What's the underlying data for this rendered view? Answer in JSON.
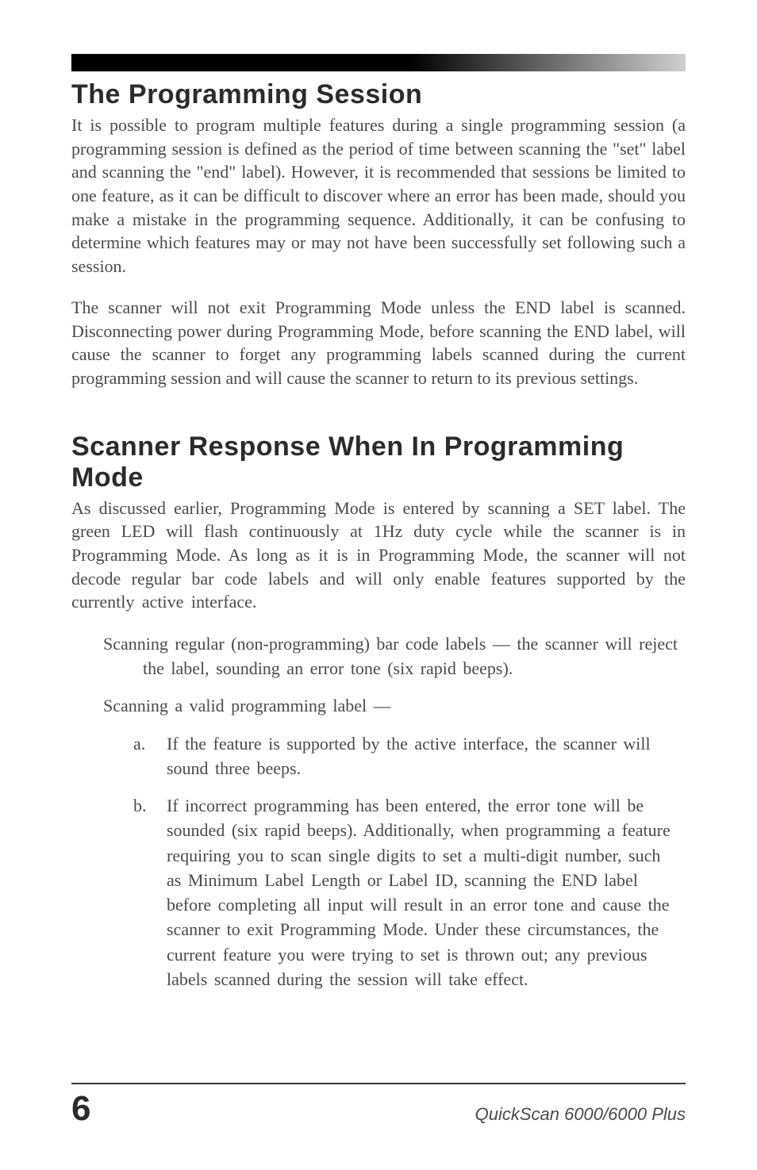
{
  "section1": {
    "title": "The Programming Session",
    "p1": "It is possible to program multiple features during a single programming session (a programming session is defined as the period of time between scanning the \"set\" label and scanning the \"end\" label).  However, it is recommended that sessions be limited to one feature, as it can be difficult to discover where an error has been made, should you make a mistake in the programming sequence.  Additionally, it can be confusing to determine which features may or may not have been successfully set following such a session.",
    "p2": "The scanner will not exit Programming Mode unless the END label is scanned. Disconnecting power during Programming Mode, before scanning the END label, will cause the scanner to forget any programming labels scanned during the current programming session and will cause the scanner to return to its previous settings."
  },
  "section2": {
    "title": "Scanner Response When In Programming Mode",
    "p1": "As discussed earlier, Programming Mode is entered by scanning a SET label.  The green LED will flash continuously at 1Hz duty cycle while the scanner is in Programming Mode.  As long as it is in Programming Mode, the scanner will not decode regular bar code labels and will only enable features supported by the currently active interface.",
    "bullet1": "Scanning regular (non-programming) bar code labels  —  the scanner will reject the label, sounding an error tone (six rapid beeps).",
    "bullet2": "Scanning a valid programming label  —",
    "a_letter": "a.",
    "a_text": "If the feature is supported by the active interface, the scanner will sound three beeps.",
    "b_letter": "b.",
    "b_text": "If incorrect programming has been entered, the error tone will be sounded (six rapid beeps).  Additionally, when programming a feature requiring you to scan single digits to set a multi-digit number, such as Minimum Label Length or Label ID, scanning the END label before completing all input will result in an error tone and cause the scanner to exit Programming Mode.  Under these circumstances, the current feature you were trying to set is thrown out; any previous labels scanned during the session will take effect."
  },
  "footer": {
    "page": "6",
    "title": "QuickScan 6000/6000 Plus"
  }
}
